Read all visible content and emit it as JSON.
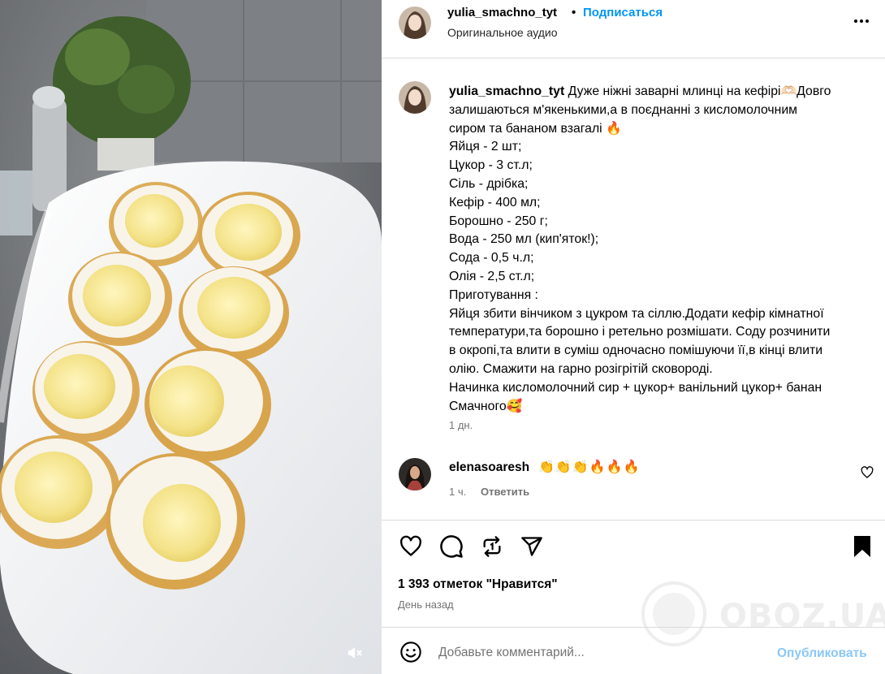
{
  "header": {
    "username": "yulia_smachno_tyt",
    "separator": "•",
    "follow_label": "Подписаться",
    "audio_label": "Оригинальное аудио",
    "more_icon": "more-horizontal-icon"
  },
  "caption": {
    "username": "yulia_smachno_tyt",
    "lines": [
      "Дуже ніжні заварні млинці на кефірі🫶🏻Довго",
      "залишаються м'якенькими,а в поєднанні з кисломолочним",
      "сиром та бананом взагалі 🔥",
      "Яйця - 2 шт;",
      "Цукор - 3 ст.л;",
      "Сіль - дрібка;",
      "Кефір - 400 мл;",
      "Борошно - 250 г;",
      "Вода - 250 мл (кип'яток!);",
      "Сода - 0,5 ч.л;",
      "Олія - 2,5 ст.л;",
      "Приготування :",
      "Яйця збити вінчиком з цукром та сіллю.Додати кефір кімнатної",
      "температури,та борошно і ретельно розмішати. Соду розчинити",
      "в окропі,та влити в суміш одночасно помішуючи її,в кінці влити",
      "олію. Смажити на гарно розігрітій сковороді.",
      "Начинка кисломолочний сир + цукор+ ванільний цукор+ банан",
      "Смачного🥰"
    ],
    "time": "1 дн."
  },
  "comment": {
    "username": "elenasoaresh",
    "text": "👏👏👏🔥🔥🔥",
    "time": "1 ч.",
    "reply_label": "Ответить",
    "like_icon": "heart-outline-icon"
  },
  "actions": {
    "like_icon": "heart-icon",
    "comment_icon": "comment-icon",
    "repost_icon": "repost-icon",
    "share_icon": "share-icon",
    "save_icon": "bookmark-icon"
  },
  "likes_text": "1 393 отметок \"Нравится\"",
  "posted_text": "День назад",
  "add_comment": {
    "placeholder": "Добавьте комментарий...",
    "post_label": "Опубликовать",
    "emoji_icon": "smiley-icon"
  },
  "media": {
    "mute_icon": "speaker-muted-icon"
  },
  "watermark": "OBOZ.UA",
  "colors": {
    "link_blue": "#0095f6",
    "post_blue_disabled": "#8ac8f8",
    "secondary_text": "#737373",
    "divider": "#dbdbdb"
  }
}
